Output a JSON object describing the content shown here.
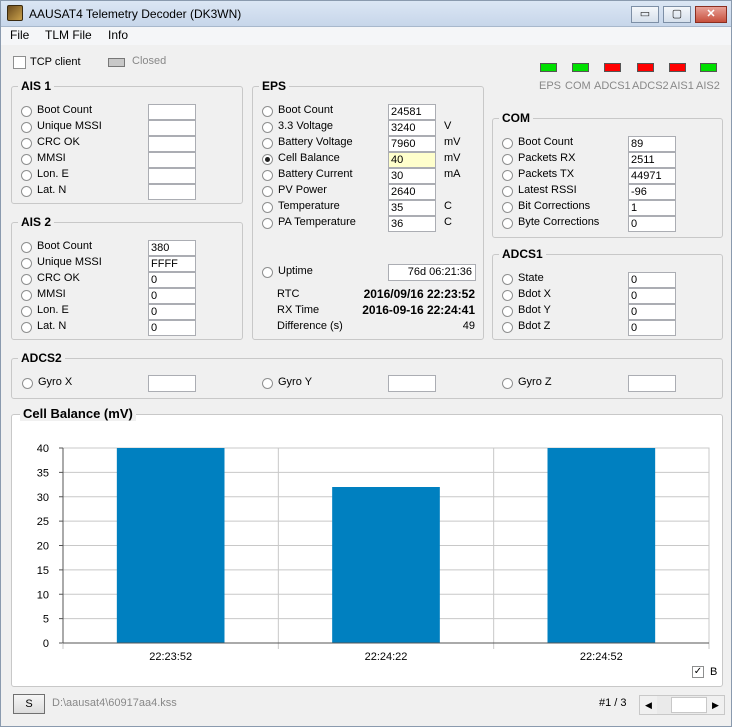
{
  "window": {
    "title": "AAUSAT4 Telemetry Decoder (DK3WN)",
    "min": "▭",
    "max": "▢",
    "close": "✕"
  },
  "menu": [
    "File",
    "TLM File",
    "Info"
  ],
  "tcp": {
    "label": "TCP client",
    "status": "Closed"
  },
  "leds": [
    {
      "label": "EPS",
      "color": "#00e000"
    },
    {
      "label": "COM",
      "color": "#00e000"
    },
    {
      "label": "ADCS1",
      "color": "#ff0000"
    },
    {
      "label": "ADCS2",
      "color": "#ff0000"
    },
    {
      "label": "AIS1",
      "color": "#ff0000"
    },
    {
      "label": "AIS2",
      "color": "#00e000"
    }
  ],
  "ais1": {
    "title": "AIS 1",
    "rows": [
      {
        "label": "Boot Count",
        "value": ""
      },
      {
        "label": "Unique MSSI",
        "value": ""
      },
      {
        "label": "CRC OK",
        "value": ""
      },
      {
        "label": "MMSI",
        "value": ""
      },
      {
        "label": "Lon. E",
        "value": ""
      },
      {
        "label": "Lat. N",
        "value": ""
      }
    ]
  },
  "ais2": {
    "title": "AIS 2",
    "rows": [
      {
        "label": "Boot Count",
        "value": "380"
      },
      {
        "label": "Unique MSSI",
        "value": "FFFF"
      },
      {
        "label": "CRC OK",
        "value": "0"
      },
      {
        "label": "MMSI",
        "value": "0"
      },
      {
        "label": "Lon. E",
        "value": "0"
      },
      {
        "label": "Lat. N",
        "value": "0"
      }
    ]
  },
  "eps": {
    "title": "EPS",
    "rows": [
      {
        "label": "Boot Count",
        "value": "24581",
        "unit": ""
      },
      {
        "label": "3.3 Voltage",
        "value": "3240",
        "unit": "V"
      },
      {
        "label": "Battery Voltage",
        "value": "7960",
        "unit": "mV"
      },
      {
        "label": "Cell Balance",
        "value": "40",
        "unit": "mV"
      },
      {
        "label": "Battery Current",
        "value": "30",
        "unit": "mA"
      },
      {
        "label": "PV Power",
        "value": "2640",
        "unit": ""
      },
      {
        "label": "Temperature",
        "value": "35",
        "unit": "C"
      },
      {
        "label": "PA Temperature",
        "value": "36",
        "unit": "C"
      }
    ],
    "uptime_label": "Uptime",
    "uptime_value": "76d 06:21:36",
    "rtc_label": "RTC",
    "rtc_value": "2016/09/16 22:23:52",
    "rx_label": "RX Time",
    "rx_value": "2016-09-16 22:24:41",
    "diff_label": "Difference (s)",
    "diff_value": "49"
  },
  "com": {
    "title": "COM",
    "rows": [
      {
        "label": "Boot Count",
        "value": "89"
      },
      {
        "label": "Packets RX",
        "value": "2511"
      },
      {
        "label": "Packets TX",
        "value": "44971"
      },
      {
        "label": "Latest RSSI",
        "value": "-96"
      },
      {
        "label": "Bit Corrections",
        "value": "1"
      },
      {
        "label": "Byte Corrections",
        "value": "0"
      }
    ]
  },
  "adcs1": {
    "title": "ADCS1",
    "rows": [
      {
        "label": "State",
        "value": "0"
      },
      {
        "label": "Bdot X",
        "value": "0"
      },
      {
        "label": "Bdot Y",
        "value": "0"
      },
      {
        "label": "Bdot Z",
        "value": "0"
      }
    ]
  },
  "adcs2": {
    "title": "ADCS2",
    "rows": [
      {
        "label": "Gyro X",
        "value": ""
      },
      {
        "label": "Gyro Y",
        "value": ""
      },
      {
        "label": "Gyro Z",
        "value": ""
      }
    ]
  },
  "chart_data": {
    "type": "bar",
    "title": "Cell Balance (mV)",
    "categories": [
      "22:23:52",
      "22:24:22",
      "22:24:52"
    ],
    "values": [
      40,
      32,
      40
    ],
    "ylim": [
      0,
      40
    ],
    "yticks": [
      0,
      5,
      10,
      15,
      20,
      25,
      30,
      35,
      40
    ],
    "grid": true,
    "bar_color": "#0080c0"
  },
  "b_check_label": "B",
  "footer": {
    "button": "S",
    "path": "D:\\aausat4\\60917aa4.kss",
    "page": "#1 / 3"
  }
}
